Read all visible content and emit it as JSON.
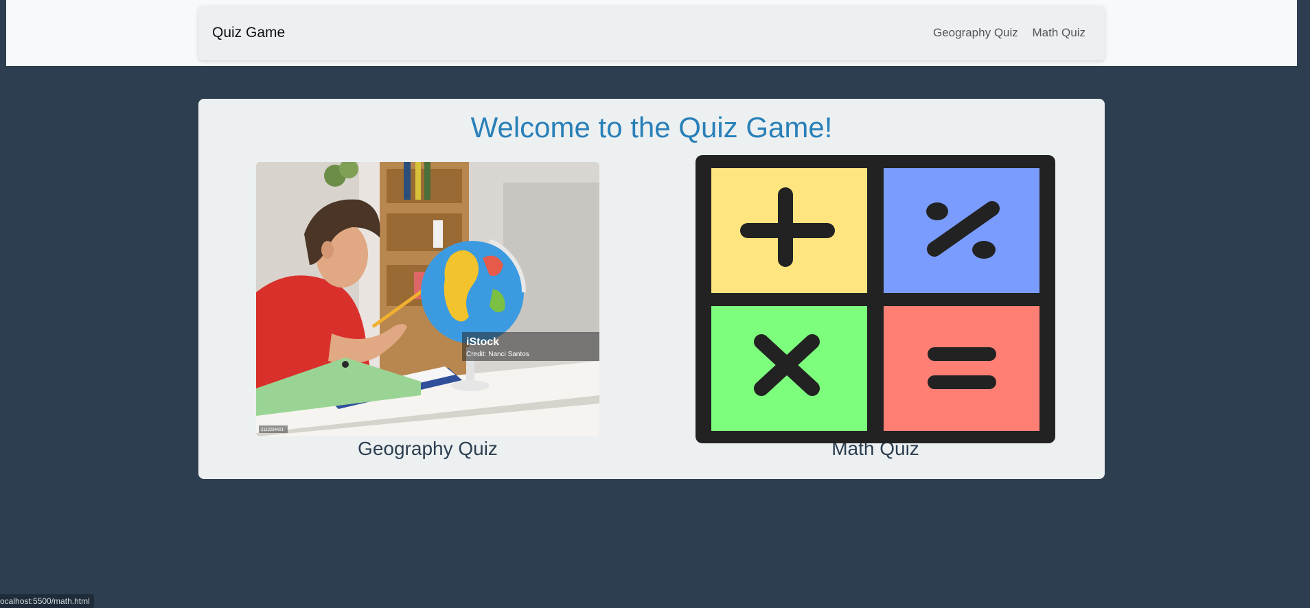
{
  "navbar": {
    "brand": "Quiz Game",
    "links": [
      "Geography Quiz",
      "Math Quiz"
    ]
  },
  "main": {
    "title": "Welcome to the Quiz Game!",
    "quizzes": [
      {
        "label": "Geography Quiz",
        "watermark": "iStock",
        "credit": "Credit: Nanci Santos",
        "image_id": "2112294421"
      },
      {
        "label": "Math Quiz",
        "symbols": [
          "+",
          "%",
          "×",
          "="
        ]
      }
    ]
  },
  "status_bar": {
    "url": "ocalhost:5500/math.html"
  },
  "colors": {
    "background": "#2d3e50",
    "card": "#ecf0f1",
    "title": "#2980b9",
    "plus_tile": "#ffe57f",
    "percent_tile": "#7b9cff",
    "times_tile": "#7dff7d",
    "equals_tile": "#ff7f74",
    "icon_frame": "#222222"
  }
}
